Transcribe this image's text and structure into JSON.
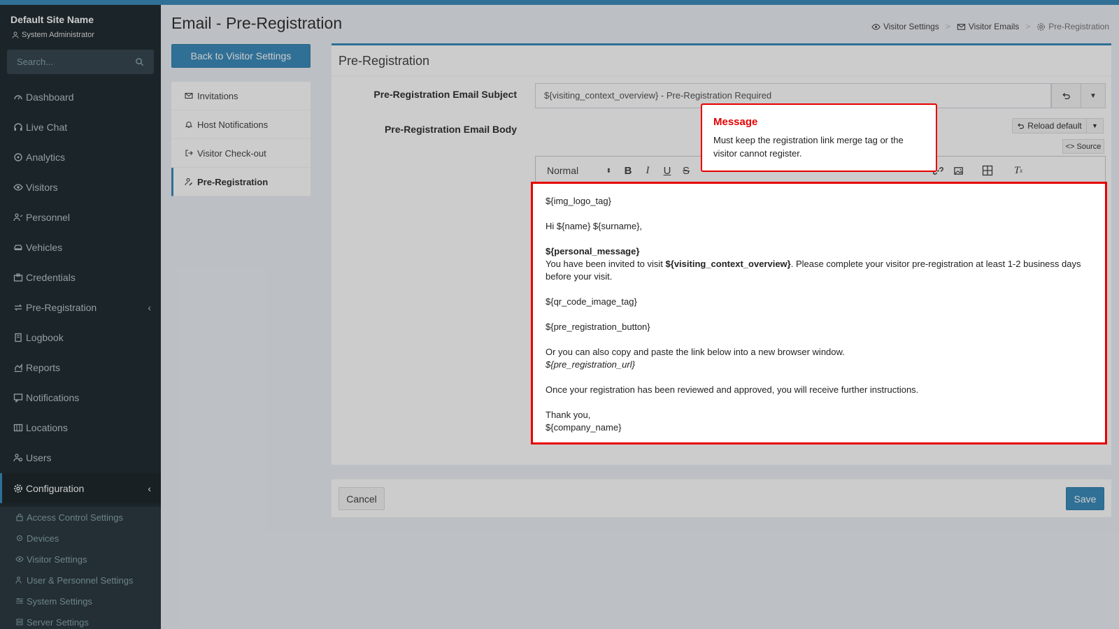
{
  "sidebar": {
    "site_name": "Default Site Name",
    "role": "System Administrator",
    "search_placeholder": "Search...",
    "items": [
      {
        "label": "Dashboard"
      },
      {
        "label": "Live Chat"
      },
      {
        "label": "Analytics"
      },
      {
        "label": "Visitors"
      },
      {
        "label": "Personnel"
      },
      {
        "label": "Vehicles"
      },
      {
        "label": "Credentials"
      },
      {
        "label": "Pre-Registration"
      },
      {
        "label": "Logbook"
      },
      {
        "label": "Reports"
      },
      {
        "label": "Notifications"
      },
      {
        "label": "Locations"
      },
      {
        "label": "Users"
      },
      {
        "label": "Configuration"
      }
    ],
    "config_sub": [
      {
        "label": "Access Control Settings"
      },
      {
        "label": "Devices"
      },
      {
        "label": "Visitor Settings"
      },
      {
        "label": "User & Personnel Settings"
      },
      {
        "label": "System Settings"
      },
      {
        "label": "Server Settings"
      }
    ]
  },
  "header": {
    "title": "Email - Pre-Registration",
    "breadcrumb": [
      "Visitor Settings",
      "Visitor Emails",
      "Pre-Registration"
    ]
  },
  "back_button": "Back to Visitor Settings",
  "email_list": [
    "Invitations",
    "Host Notifications",
    "Visitor Check-out",
    "Pre-Registration"
  ],
  "box": {
    "title": "Pre-Registration",
    "subject_label": "Pre-Registration Email Subject",
    "subject_value": "${visiting_context_overview} - Pre-Registration Required",
    "body_label": "Pre-Registration Email Body",
    "reload_label": "Reload default",
    "source_label": "<> Source",
    "format_select": "Normal"
  },
  "editor": {
    "line1": "${img_logo_tag}",
    "line2": "Hi ${name} ${surname},",
    "line3": "${personal_message}",
    "line4a": "You have been invited to visit ",
    "line4b": "${visiting_context_overview}",
    "line4c": ". Please complete your visitor pre-registration at least 1-2 business days before your visit.",
    "line5": "${qr_code_image_tag}",
    "line6": "${pre_registration_button}",
    "line7": "Or you can also copy and paste the link below into a new browser window.",
    "line8": "${pre_registration_url}",
    "line9": "Once your registration has been reviewed and approved, you will receive further instructions.",
    "line10": "Thank you,",
    "line11": "${company_name}"
  },
  "footer": {
    "cancel": "Cancel",
    "save": "Save"
  },
  "tooltip": {
    "title": "Message",
    "body": "Must keep the registration link merge tag or the visitor cannot register."
  },
  "colors": {
    "accent": "#3c8dbc",
    "sidebar": "#222d32",
    "highlight": "#e60000"
  }
}
